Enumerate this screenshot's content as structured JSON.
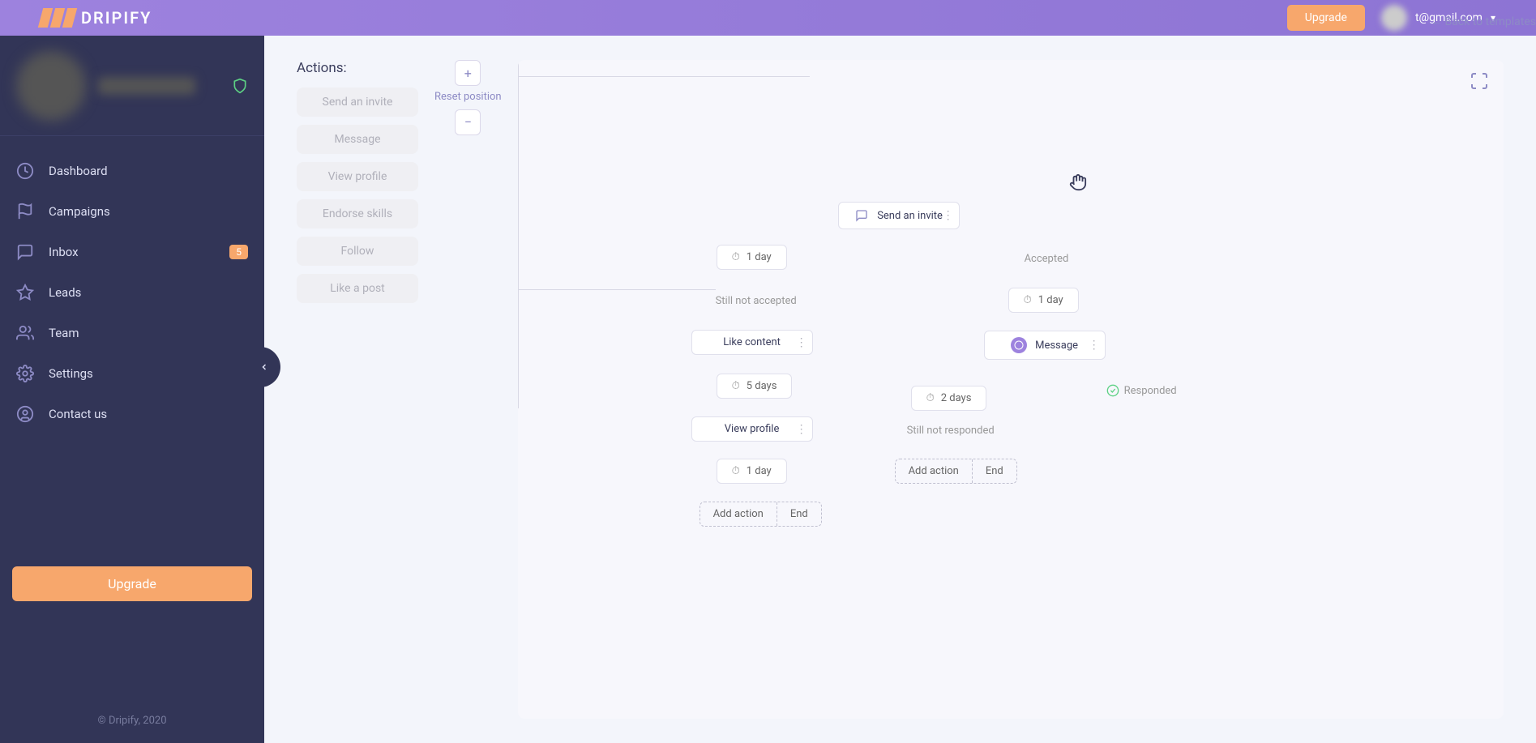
{
  "header": {
    "logo_text": "DRIPIFY",
    "upgrade": "Upgrade",
    "user_email": "t@gmail.com"
  },
  "sidebar": {
    "items": [
      {
        "label": "Dashboard",
        "icon": "clock"
      },
      {
        "label": "Campaigns",
        "icon": "flag"
      },
      {
        "label": "Inbox",
        "icon": "chat",
        "badge": "5"
      },
      {
        "label": "Leads",
        "icon": "star"
      },
      {
        "label": "Team",
        "icon": "users"
      },
      {
        "label": "Settings",
        "icon": "gear"
      },
      {
        "label": "Contact us",
        "icon": "user"
      }
    ],
    "upgrade": "Upgrade",
    "copyright": "© Dripify, 2020"
  },
  "actions_panel": {
    "title": "Actions:",
    "items": [
      "Send an invite",
      "Message",
      "View profile",
      "Endorse skills",
      "Follow",
      "Like a post"
    ]
  },
  "canvas_controls": {
    "zoom_in": "+",
    "reset": "Reset position",
    "zoom_out": "−"
  },
  "canvas": {
    "back_link": "← Back to templates"
  },
  "flow": {
    "send_invite": "Send an invite",
    "accepted": "Accepted",
    "not_accepted": "Still not accepted",
    "one_day": "1 day",
    "like_content": "Like content",
    "five_days": "5 days",
    "view_profile": "View profile",
    "message": "Message",
    "two_days": "2 days",
    "responded": "Responded",
    "not_responded": "Still not responded",
    "add_action": "Add action",
    "end": "End"
  }
}
